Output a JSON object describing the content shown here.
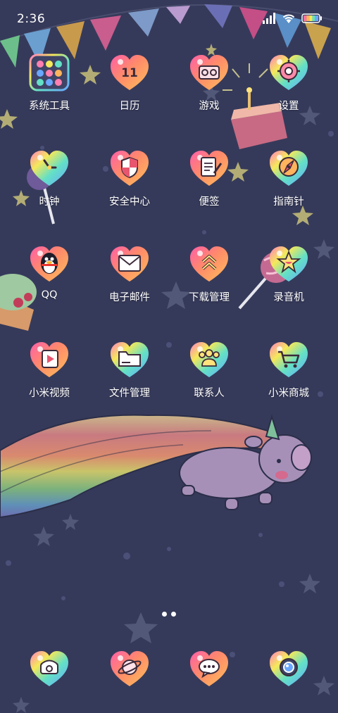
{
  "status_bar": {
    "time": "2:36",
    "signal_icon": "signal-bars-icon",
    "wifi_icon": "wifi-icon",
    "battery_icon": "battery-icon"
  },
  "apps": [
    {
      "label": "系统工具",
      "icon": "folder-grid-icon"
    },
    {
      "label": "日历",
      "icon": "calendar-icon"
    },
    {
      "label": "游戏",
      "icon": "gamepad-icon"
    },
    {
      "label": "设置",
      "icon": "gear-icon"
    },
    {
      "label": "时钟",
      "icon": "clock-icon"
    },
    {
      "label": "安全中心",
      "icon": "shield-icon"
    },
    {
      "label": "便签",
      "icon": "notepad-icon"
    },
    {
      "label": "指南针",
      "icon": "compass-icon"
    },
    {
      "label": "QQ",
      "icon": "penguin-icon"
    },
    {
      "label": "电子邮件",
      "icon": "envelope-icon"
    },
    {
      "label": "下载管理",
      "icon": "download-chevrons-icon"
    },
    {
      "label": "录音机",
      "icon": "recorder-star-icon"
    },
    {
      "label": "小米视频",
      "icon": "video-play-icon"
    },
    {
      "label": "文件管理",
      "icon": "folder-icon"
    },
    {
      "label": "联系人",
      "icon": "contacts-icon"
    },
    {
      "label": "小米商城",
      "icon": "shopping-cart-icon"
    }
  ],
  "calendar_day": "11",
  "dock": [
    {
      "icon": "phone-icon"
    },
    {
      "icon": "browser-planet-icon"
    },
    {
      "icon": "chat-bubble-icon"
    },
    {
      "icon": "camera-icon"
    }
  ],
  "page_indicator": {
    "pages": 2,
    "current": 1
  },
  "colors": {
    "background": "#363a5a",
    "heart_gradient": [
      "#ff5fa8",
      "#ffb35c",
      "#f5e85a",
      "#63e0c6",
      "#6aa7ff"
    ]
  }
}
